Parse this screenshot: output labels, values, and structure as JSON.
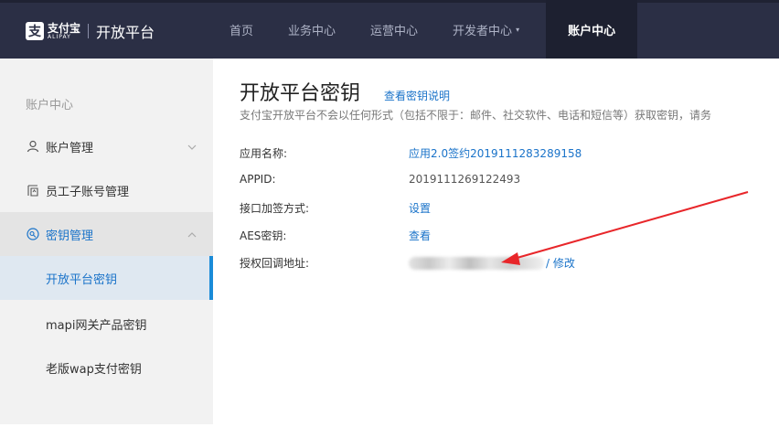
{
  "header": {
    "logo_mark": "支",
    "logo_cn": "支付宝",
    "logo_en": "ALIPAY",
    "title": "开放平台",
    "nav": [
      {
        "label": "首页"
      },
      {
        "label": "业务中心"
      },
      {
        "label": "运营中心"
      },
      {
        "label": "开发者中心"
      },
      {
        "label": "账户中心"
      }
    ],
    "caret": "▾"
  },
  "sidebar": {
    "heading": "账户中心",
    "items": [
      {
        "label": "账户管理",
        "icon": "person-icon"
      },
      {
        "label": "员工子账号管理",
        "icon": "staff-icon"
      },
      {
        "label": "密钥管理",
        "icon": "key-icon"
      }
    ],
    "sub_items": [
      {
        "label": "开放平台密钥"
      },
      {
        "label": "mapi网关产品密钥"
      },
      {
        "label": "老版wap支付密钥"
      }
    ]
  },
  "main": {
    "title": "开放平台密钥",
    "title_link": "查看密钥说明",
    "subtitle": "支付宝开放平台不会以任何形式（包括不限于：邮件、社交软件、电话和短信等）获取密钥，请务",
    "fields": [
      {
        "label": "应用名称:",
        "value": "应用2.0签约2019111283289158"
      },
      {
        "label": "APPID:",
        "value": "2019111269122493"
      },
      {
        "label": "接口加签方式:",
        "value": "设置"
      },
      {
        "label": "AES密钥:",
        "value": "查看"
      },
      {
        "label": "授权回调地址:",
        "value": "/ 修改"
      }
    ]
  },
  "colors": {
    "header_bg": "#2b2f45",
    "accent": "#1a73c9",
    "arrow": "#e8262a"
  }
}
